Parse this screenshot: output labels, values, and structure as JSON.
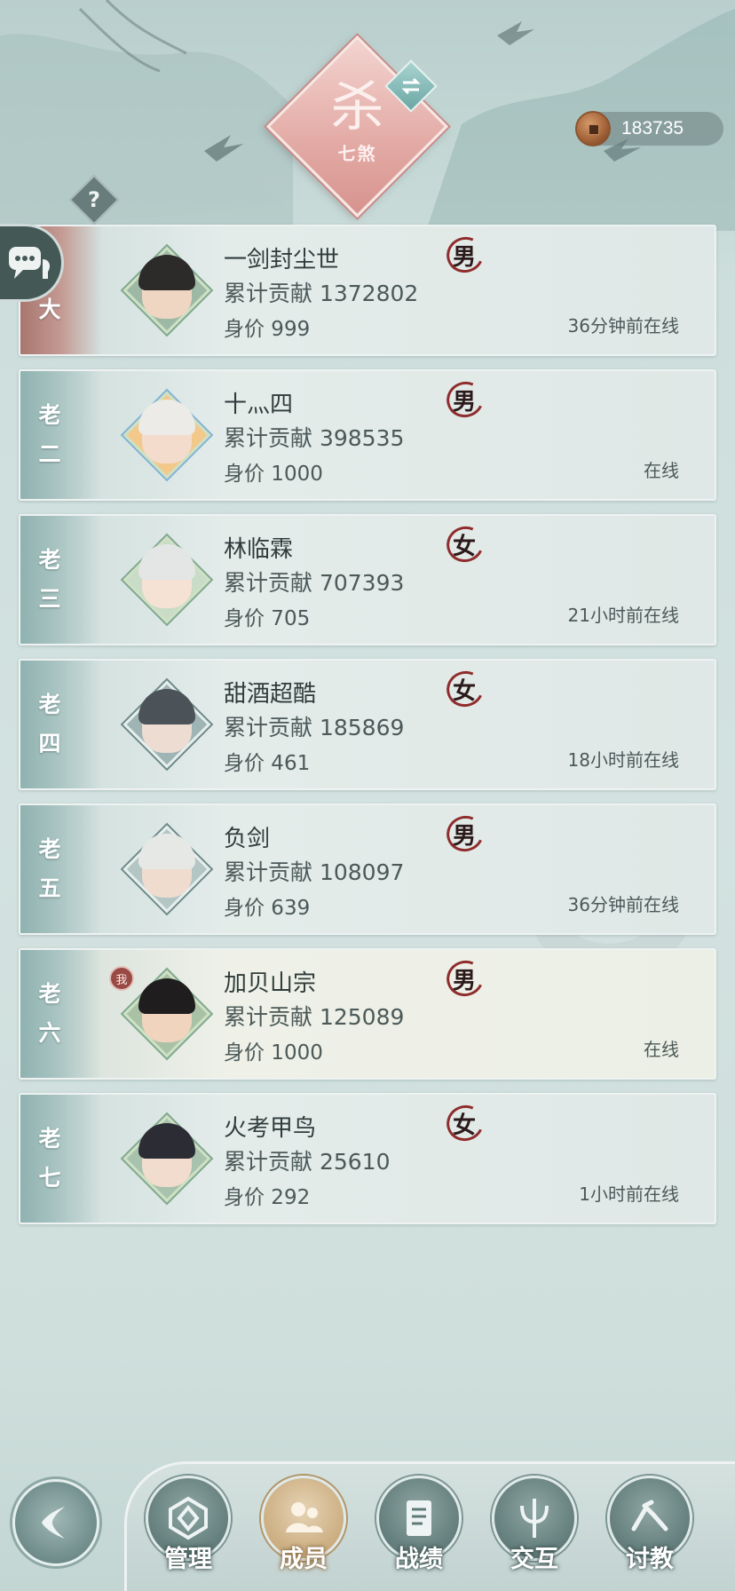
{
  "header": {
    "sect_name": "七煞",
    "sect_glyph": "杀",
    "switch_icon": "swap-icon",
    "help_label": "?",
    "currency": {
      "icon": "copper-coin-icon",
      "value": "183735"
    }
  },
  "labels": {
    "contribution_prefix": "累计贡献",
    "worth_prefix": "身价"
  },
  "members": [
    {
      "rank": "老大",
      "name": "一剑封尘世",
      "gender": "男",
      "contribution": "累计贡献 1372802",
      "worth": "身价 999",
      "status": "36分钟前在线",
      "leader": true,
      "self": false
    },
    {
      "rank": "老二",
      "name": "十灬四",
      "gender": "男",
      "contribution": "累计贡献 398535",
      "worth": "身价 1000",
      "status": "在线",
      "leader": false,
      "self": false
    },
    {
      "rank": "老三",
      "name": "林临霖",
      "gender": "女",
      "contribution": "累计贡献 707393",
      "worth": "身价 705",
      "status": "21小时前在线",
      "leader": false,
      "self": false
    },
    {
      "rank": "老四",
      "name": "甜酒超酷",
      "gender": "女",
      "contribution": "累计贡献 185869",
      "worth": "身价 461",
      "status": "18小时前在线",
      "leader": false,
      "self": false
    },
    {
      "rank": "老五",
      "name": "负剑",
      "gender": "男",
      "contribution": "累计贡献 108097",
      "worth": "身价 639",
      "status": "36分钟前在线",
      "leader": false,
      "self": false
    },
    {
      "rank": "老六",
      "name": "加贝山宗",
      "gender": "男",
      "contribution": "累计贡献 125089",
      "worth": "身价 1000",
      "status": "在线",
      "leader": false,
      "self": true,
      "me_badge": "我"
    },
    {
      "rank": "老七",
      "name": "火考甲鸟",
      "gender": "女",
      "contribution": "累计贡献 25610",
      "worth": "身价 292",
      "status": "1小时前在线",
      "leader": false,
      "self": false
    }
  ],
  "nav": {
    "back_icon": "back-arrow-icon",
    "items": [
      {
        "label": "管理",
        "icon": "manage-icon",
        "active": false
      },
      {
        "label": "成员",
        "icon": "members-icon",
        "active": true
      },
      {
        "label": "战绩",
        "icon": "record-scroll-icon",
        "active": false
      },
      {
        "label": "交互",
        "icon": "interact-trident-icon",
        "active": false
      },
      {
        "label": "讨教",
        "icon": "challenge-icon",
        "active": false
      }
    ]
  },
  "colors": {
    "male_ring": "#8f2c2c",
    "leader_strip": "#a8766f",
    "rank_strip": "#8fb2b0",
    "active_nav": "#c9ab7d"
  }
}
